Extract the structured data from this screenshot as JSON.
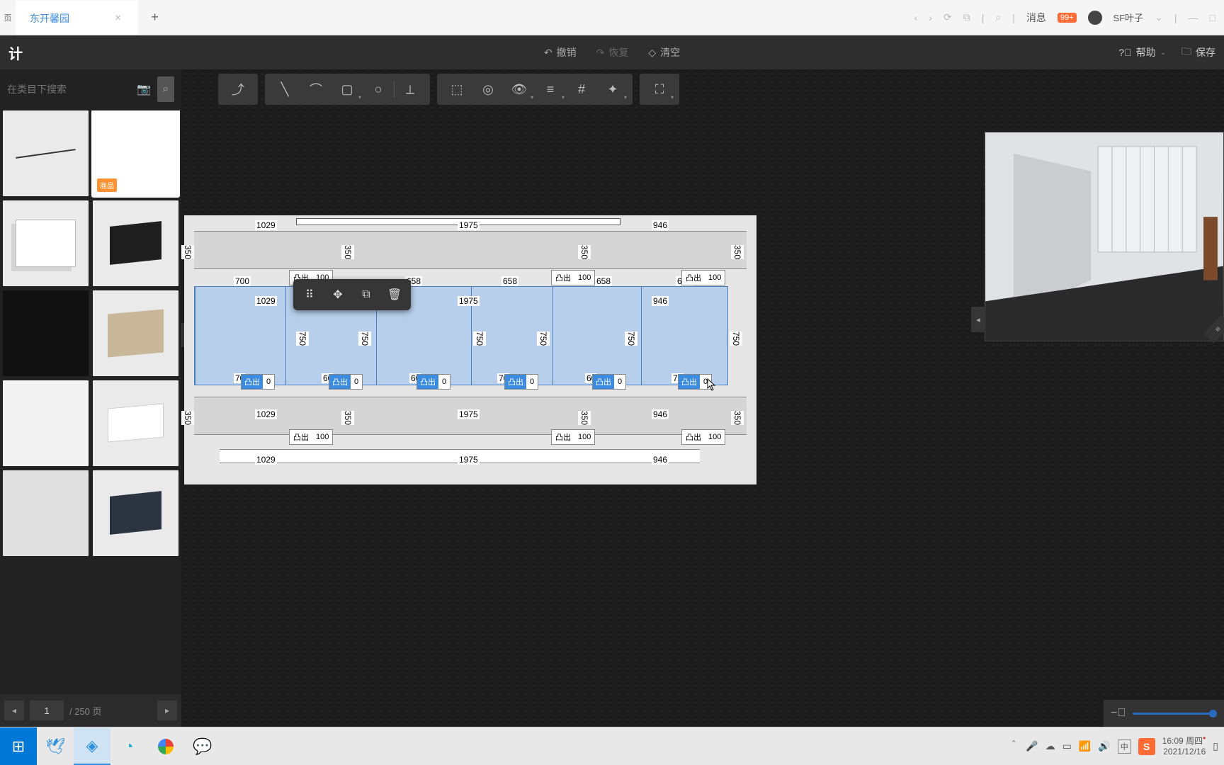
{
  "tabbar": {
    "home_label": "页",
    "active_tab": "东开馨园",
    "close": "×",
    "new_tab": "+",
    "messages_label": "消息",
    "messages_badge": "99+",
    "username": "SF叶子"
  },
  "toolbar": {
    "logo": "计",
    "undo": "撤销",
    "redo": "恢复",
    "clear": "清空",
    "help": "帮助",
    "save": "保存"
  },
  "sidebar": {
    "search_placeholder": "在类目下搜索",
    "badge": "商品",
    "page_current": "1",
    "page_total": "/ 250 页"
  },
  "canvas": {
    "dims_top": [
      "1029",
      "1975",
      "946"
    ],
    "dims_row2": [
      "700",
      "658",
      "658",
      "658",
      "617"
    ],
    "dims_sel_top": [
      "1029",
      "1975",
      "946"
    ],
    "dims_sel_bot": [
      "70",
      "60",
      "60",
      "70",
      "60",
      "70"
    ],
    "dims_bottom1": [
      "1029",
      "1975",
      "946"
    ],
    "dims_bottom2": [
      "1029",
      "1975",
      "946"
    ],
    "dims_v_350": "350",
    "dims_v_750": "750",
    "tu_label": "凸出",
    "tu_100": "100",
    "tu_0": "0"
  },
  "taskbar": {
    "time": "16:09",
    "day": "周四",
    "date": "2021/12/16",
    "ime": "中"
  }
}
